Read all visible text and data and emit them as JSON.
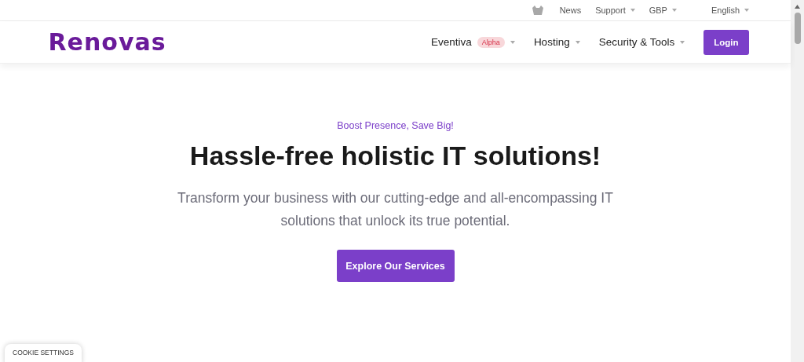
{
  "top_bar": {
    "links": [
      {
        "label": "News",
        "dropdown": false
      },
      {
        "label": "Support",
        "dropdown": true
      },
      {
        "label": "GBP",
        "dropdown": true
      },
      {
        "label": "English",
        "dropdown": true
      }
    ]
  },
  "header": {
    "logo": "Renovas",
    "nav": [
      {
        "label": "Eventiva",
        "badge": "Alpha",
        "dropdown": true
      },
      {
        "label": "Hosting",
        "dropdown": true
      },
      {
        "label": "Security & Tools",
        "dropdown": true
      }
    ],
    "login": "Login"
  },
  "hero": {
    "eyebrow": "Boost Presence, Save Big!",
    "title": "Hassle-free holistic IT solutions!",
    "subtitle": "Transform your business with our cutting-edge and all-encompassing IT solutions that unlock its true potential.",
    "button": "Explore Our Services"
  },
  "cookie_button": "COOKIE SETTINGS"
}
